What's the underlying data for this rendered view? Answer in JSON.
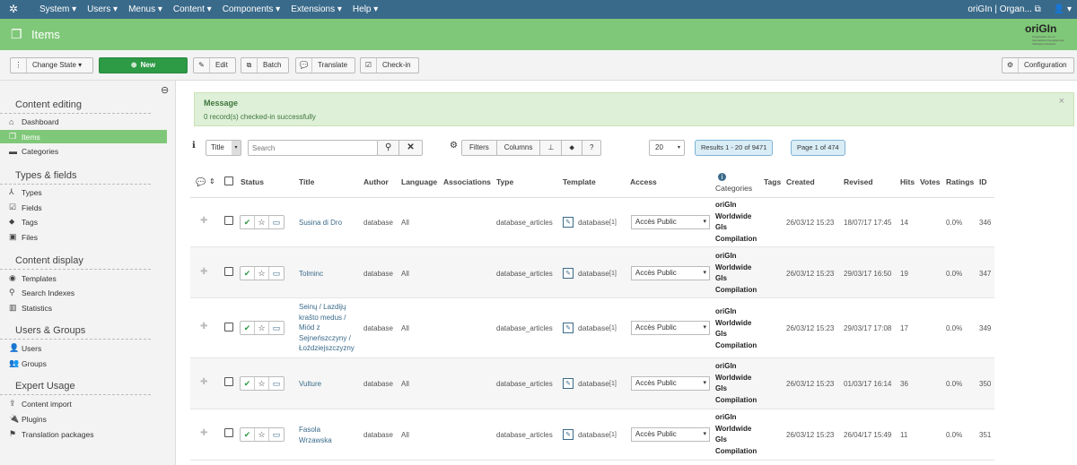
{
  "topbar": {
    "menu": [
      "System ▾",
      "Users ▾",
      "Menus ▾",
      "Content ▾",
      "Components ▾",
      "Extensions ▾",
      "Help ▾"
    ],
    "site": "oriGIn | Organ... ⧉",
    "user": "👤 ▾"
  },
  "header": {
    "title": "Items",
    "logo": "oriGIn",
    "logo_sub": "Organisation for an International Geographical Indications Network"
  },
  "toolbar": {
    "change_state": "Change State ▾",
    "new": "New",
    "edit": "Edit",
    "batch": "Batch",
    "translate": "Translate",
    "checkin": "Check-in",
    "configuration": "Configuration"
  },
  "sidebar": {
    "sections": [
      {
        "title": "Content editing",
        "items": [
          "Dashboard",
          "Items",
          "Categories"
        ]
      },
      {
        "title": "Types & fields",
        "items": [
          "Types",
          "Fields",
          "Tags",
          "Files"
        ]
      },
      {
        "title": "Content display",
        "items": [
          "Templates",
          "Search Indexes",
          "Statistics"
        ]
      },
      {
        "title": "Users & Groups",
        "items": [
          "Users",
          "Groups"
        ]
      },
      {
        "title": "Expert Usage",
        "items": [
          "Content import",
          "Plugins",
          "Translation packages"
        ]
      }
    ]
  },
  "message": {
    "heading": "Message",
    "text": "0 record(s) checked-in successfully",
    "close": "×"
  },
  "filterbar": {
    "search_field": "Title",
    "search_placeholder": "Search",
    "filters": "Filters",
    "columns": "Columns",
    "limit": "20",
    "results": "Results 1 - 20 of 9471",
    "page": "Page 1 of 474"
  },
  "columns": {
    "status": "Status",
    "title": "Title",
    "author": "Author",
    "language": "Language",
    "associations": "Associations",
    "type": "Type",
    "template": "Template",
    "access": "Access",
    "categories": "Categories",
    "tags": "Tags",
    "created": "Created",
    "revised": "Revised",
    "hits": "Hits",
    "votes": "Votes",
    "ratings": "Ratings",
    "id": "ID"
  },
  "rows": [
    {
      "title": "Susina di Dro",
      "author": "database",
      "language": "All",
      "type": "database_articles",
      "template": "database",
      "template_ref": "[1]",
      "access": "Accès Public",
      "categories": [
        "oriGIn",
        "Worldwide",
        "GIs",
        "Compilation"
      ],
      "created": "26/03/12 15:23",
      "revised": "18/07/17 17:45",
      "hits": "14",
      "ratings": "0.0%",
      "id": "346"
    },
    {
      "title": "Tolminc",
      "author": "database",
      "language": "All",
      "type": "database_articles",
      "template": "database",
      "template_ref": "[1]",
      "access": "Accès Public",
      "categories": [
        "oriGIn",
        "Worldwide",
        "GIs",
        "Compilation"
      ],
      "created": "26/03/12 15:23",
      "revised": "29/03/17 16:50",
      "hits": "19",
      "ratings": "0.0%",
      "id": "347"
    },
    {
      "title": "Seinų / Lazdijų krašto medus / Miód z Sejneńszczyny / Łoździejszczyzny",
      "title_lines": [
        "Seinų / Lazdijų",
        "krašto medus /",
        "Miód z",
        "Sejneńszczyny /",
        "Łoździejszczyzny"
      ],
      "author": "database",
      "language": "All",
      "type": "database_articles",
      "template": "database",
      "template_ref": "[1]",
      "access": "Accès Public",
      "categories": [
        "oriGIn",
        "Worldwide",
        "GIs",
        "Compilation"
      ],
      "created": "26/03/12 15:23",
      "revised": "29/03/17 17:08",
      "hits": "17",
      "ratings": "0.0%",
      "id": "349"
    },
    {
      "title": "Vulture",
      "author": "database",
      "language": "All",
      "type": "database_articles",
      "template": "database",
      "template_ref": "[1]",
      "access": "Accès Public",
      "categories": [
        "oriGIn",
        "Worldwide",
        "GIs",
        "Compilation"
      ],
      "created": "26/03/12 15:23",
      "revised": "01/03/17 16:14",
      "hits": "36",
      "ratings": "0.0%",
      "id": "350"
    },
    {
      "title": "Fasola Wrzawska",
      "title_lines": [
        "Fasola",
        "Wrzawska"
      ],
      "author": "database",
      "language": "All",
      "type": "database_articles",
      "template": "database",
      "template_ref": "[1]",
      "access": "Accès Public",
      "categories": [
        "oriGIn",
        "Worldwide",
        "GIs",
        "Compilation"
      ],
      "created": "26/03/12 15:23",
      "revised": "26/04/17 15:49",
      "hits": "11",
      "ratings": "0.0%",
      "id": "351"
    }
  ]
}
